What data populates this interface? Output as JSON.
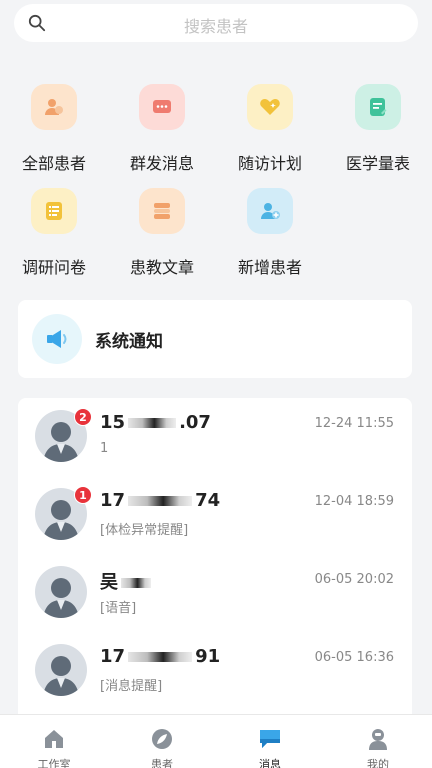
{
  "search": {
    "placeholder": "搜索患者",
    "icon": "search-icon"
  },
  "grid": [
    {
      "label": "全部患者",
      "icon": "all-patients-icon",
      "bg": "#fde4cc",
      "fg": "#f1a16a"
    },
    {
      "label": "群发消息",
      "icon": "broadcast-message-icon",
      "bg": "#fddbd7",
      "fg": "#ef7b6f"
    },
    {
      "label": "随访计划",
      "icon": "followup-plan-icon",
      "bg": "#fdf0c5",
      "fg": "#f2c23a"
    },
    {
      "label": "医学量表",
      "icon": "medical-scale-icon",
      "bg": "#cdf0e5",
      "fg": "#3fc29a"
    },
    {
      "label": "调研问卷",
      "icon": "questionnaire-icon",
      "bg": "#fdf0c5",
      "fg": "#f2c23a"
    },
    {
      "label": "患教文章",
      "icon": "education-article-icon",
      "bg": "#fde4cc",
      "fg": "#f1a16a"
    },
    {
      "label": "新增患者",
      "icon": "add-patient-icon",
      "bg": "#d2ecf8",
      "fg": "#4cb3e3"
    }
  ],
  "notice": {
    "title": "系统通知",
    "icon": "speaker-icon"
  },
  "messages": [
    {
      "name_prefix": "15",
      "name_suffix": ".07",
      "badge": "2",
      "subtitle": "1",
      "time": "12-24 11:55"
    },
    {
      "name_prefix": "17",
      "name_suffix": "74",
      "badge": "1",
      "subtitle": "[体检异常提醒]",
      "time": "12-04 18:59"
    },
    {
      "name_prefix": "吴",
      "name_suffix": "",
      "badge": "",
      "subtitle": "[语音]",
      "time": "06-05 20:02"
    },
    {
      "name_prefix": "17",
      "name_suffix": "91",
      "badge": "",
      "subtitle": "[消息提醒]",
      "time": "06-05 16:36"
    }
  ],
  "tabs": [
    {
      "label": "工作室",
      "icon": "home-icon",
      "active": false
    },
    {
      "label": "患者",
      "icon": "leaf-icon",
      "active": false
    },
    {
      "label": "消息",
      "icon": "chat-icon",
      "active": true
    },
    {
      "label": "我的",
      "icon": "profile-icon",
      "active": false
    }
  ],
  "colors": {
    "accent": "#3aa6e8",
    "badge": "#e8333b",
    "background": "#f3f4f6"
  }
}
